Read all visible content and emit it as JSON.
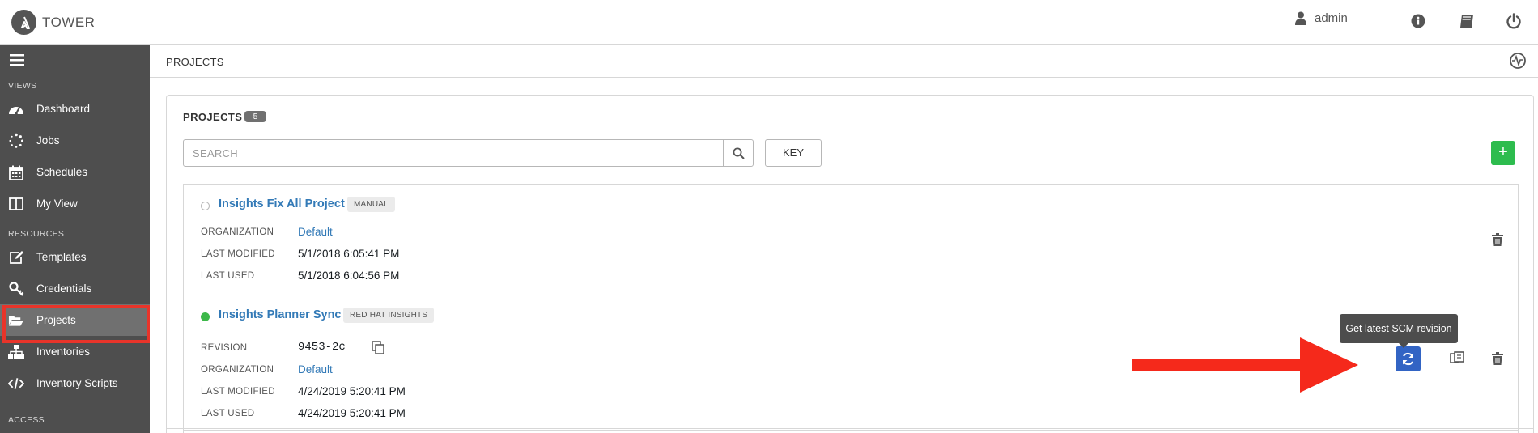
{
  "header": {
    "brand": "TOWER",
    "user": "admin",
    "icons": [
      "user-icon",
      "info-icon",
      "book-icon",
      "power-icon"
    ]
  },
  "sidebar": {
    "sections": [
      {
        "label": "VIEWS"
      },
      {
        "label": "RESOURCES"
      },
      {
        "label": "ACCESS"
      }
    ],
    "items": [
      {
        "label": "Dashboard",
        "icon": "dashboard-icon"
      },
      {
        "label": "Jobs",
        "icon": "spinner-icon"
      },
      {
        "label": "Schedules",
        "icon": "calendar-icon"
      },
      {
        "label": "My View",
        "icon": "columns-icon"
      },
      {
        "label": "Templates",
        "icon": "edit-icon"
      },
      {
        "label": "Credentials",
        "icon": "key-icon"
      },
      {
        "label": "Projects",
        "icon": "folder-open-icon",
        "active": true
      },
      {
        "label": "Inventories",
        "icon": "sitemap-icon"
      },
      {
        "label": "Inventory Scripts",
        "icon": "code-icon"
      }
    ]
  },
  "breadcrumb": {
    "current": "PROJECTS"
  },
  "panel": {
    "title": "PROJECTS",
    "count": "5",
    "search_placeholder": "SEARCH",
    "key_label": "KEY",
    "add_label": "+"
  },
  "projects": [
    {
      "name": "Insights Fix All Project",
      "type": "MANUAL",
      "status": "never-updated",
      "fields": [
        {
          "label": "ORGANIZATION",
          "value": "Default",
          "link": true
        },
        {
          "label": "LAST MODIFIED",
          "value": "5/1/2018 6:05:41 PM"
        },
        {
          "label": "LAST USED",
          "value": "5/1/2018 6:04:56 PM"
        }
      ]
    },
    {
      "name": "Insights Planner Sync",
      "type": "RED HAT INSIGHTS",
      "status": "successful",
      "fields": [
        {
          "label": "REVISION",
          "value": "9453-2c"
        },
        {
          "label": "ORGANIZATION",
          "value": "Default",
          "link": true
        },
        {
          "label": "LAST MODIFIED",
          "value": "4/24/2019 5:20:41 PM"
        },
        {
          "label": "LAST USED",
          "value": "4/24/2019 5:20:41 PM"
        }
      ]
    }
  ],
  "tooltip": "Get latest SCM revision",
  "colors": {
    "sidebar_bg": "#4e4e4e",
    "active_item": "#707070",
    "highlight": "#e8342a",
    "link": "#337ab7",
    "sync_button": "#3264c4",
    "success": "#3cb849",
    "add_button": "#2dbc4e"
  }
}
